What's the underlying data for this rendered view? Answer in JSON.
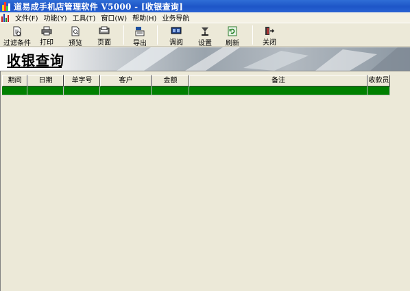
{
  "window": {
    "title": "道易成手机店管理软件 V5000 - [收银查询]"
  },
  "menu": {
    "items": [
      "文件(F)",
      "功能(Y)",
      "工具(T)",
      "窗口(W)",
      "帮助(H)",
      "业务导航"
    ]
  },
  "toolbar": {
    "buttons": [
      {
        "label": "过滤条件",
        "icon": "filter-icon"
      },
      {
        "label": "打印",
        "icon": "printer-icon"
      },
      {
        "label": "预览",
        "icon": "preview-icon"
      },
      {
        "label": "页面",
        "icon": "page-setup-icon"
      },
      {
        "label": "导出",
        "icon": "export-icon"
      },
      {
        "label": "调阅",
        "icon": "view-icon"
      },
      {
        "label": "设置",
        "icon": "settings-icon"
      },
      {
        "label": "刷新",
        "icon": "refresh-icon"
      },
      {
        "label": "关闭",
        "icon": "close-icon"
      }
    ]
  },
  "banner": {
    "title": "收银查询"
  },
  "grid": {
    "columns": [
      "期间",
      "日期",
      "单字号",
      "客户",
      "金额",
      "备注",
      "收款员"
    ],
    "selected_row_color": "#008000"
  }
}
